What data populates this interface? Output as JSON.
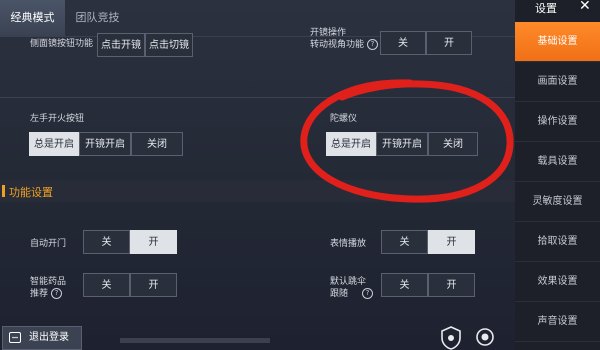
{
  "tabs": [
    {
      "label": "经典模式"
    },
    {
      "label": "团队竞技"
    }
  ],
  "top_row": {
    "left_label": "侧面镜按钮功能",
    "left_options": [
      "点击开镜",
      "点击切镜"
    ],
    "right_label_1": "开镜操作",
    "right_label_2": "转动视角功能",
    "right_options": [
      "关",
      "开"
    ]
  },
  "left_fire": {
    "label": "左手开火按钮",
    "options": [
      "总是开启",
      "开镜开启",
      "关闭"
    ],
    "selected": 0
  },
  "gyro": {
    "label": "陀螺仪",
    "options": [
      "总是开启",
      "开镜开启",
      "关闭"
    ],
    "selected": 0
  },
  "section": {
    "title": "功能设置"
  },
  "auto_door": {
    "label": "自动开门",
    "options": [
      "关",
      "开"
    ],
    "selected": 1
  },
  "emote": {
    "label": "表情播放",
    "options": [
      "关",
      "开"
    ],
    "selected": 1
  },
  "smart_med": {
    "label_1": "智能药品",
    "label_2": "推荐",
    "options": [
      "关",
      "开"
    ]
  },
  "default_follow": {
    "label_1": "默认跳伞",
    "label_2": "跟随",
    "options": [
      "关",
      "开"
    ]
  },
  "sidebar": {
    "title": "设置",
    "items": [
      {
        "label": "基础设置"
      },
      {
        "label": "画面设置"
      },
      {
        "label": "操作设置"
      },
      {
        "label": "载具设置"
      },
      {
        "label": "灵敏度设置"
      },
      {
        "label": "拾取设置"
      },
      {
        "label": "效果设置"
      },
      {
        "label": "声音设置"
      }
    ],
    "active_index": 0
  },
  "logout": {
    "label": "退出登录"
  },
  "colors": {
    "accent": "#f07016",
    "section_title": "#f0a020",
    "annotation_circle": "#e0201a"
  }
}
